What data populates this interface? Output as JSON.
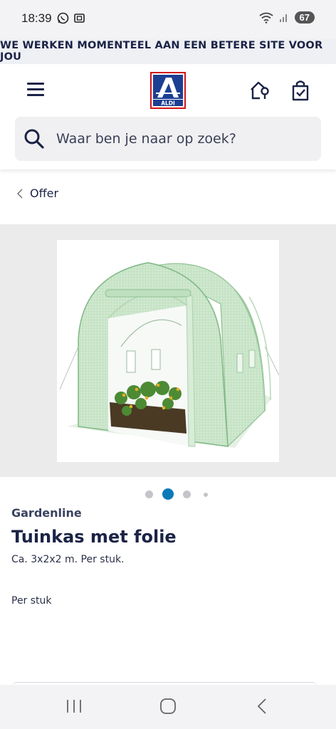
{
  "status_bar": {
    "time": "18:39",
    "battery": "67",
    "icons": [
      "whatsapp-icon",
      "screenshot-icon",
      "wifi-icon",
      "signal-icon"
    ]
  },
  "banner": {
    "text": "WE WERKEN MOMENTEEL AAN EEN BETERE SITE VOOR JOU"
  },
  "header": {
    "logo_text": "ALDI",
    "icons": [
      "menu-icon",
      "store-locator-icon",
      "shopping-bag-icon"
    ]
  },
  "search": {
    "placeholder": "Waar ben je naar op zoek?"
  },
  "breadcrumb": {
    "label": "Offer"
  },
  "gallery": {
    "dots_count": 4,
    "active_index": 1
  },
  "product": {
    "brand": "Gardenline",
    "title": "Tuinkas met folie",
    "subtitle": "Ca. 3x2x2 m. Per stuk.",
    "unit": "Per stuk"
  },
  "colors": {
    "primary": "#1b2346",
    "accent": "#0a7ab8",
    "logo_red": "#d2141a",
    "logo_blue": "#1c3f94"
  },
  "nav_bar": {
    "buttons": [
      "recents-button",
      "home-button",
      "back-button"
    ]
  }
}
